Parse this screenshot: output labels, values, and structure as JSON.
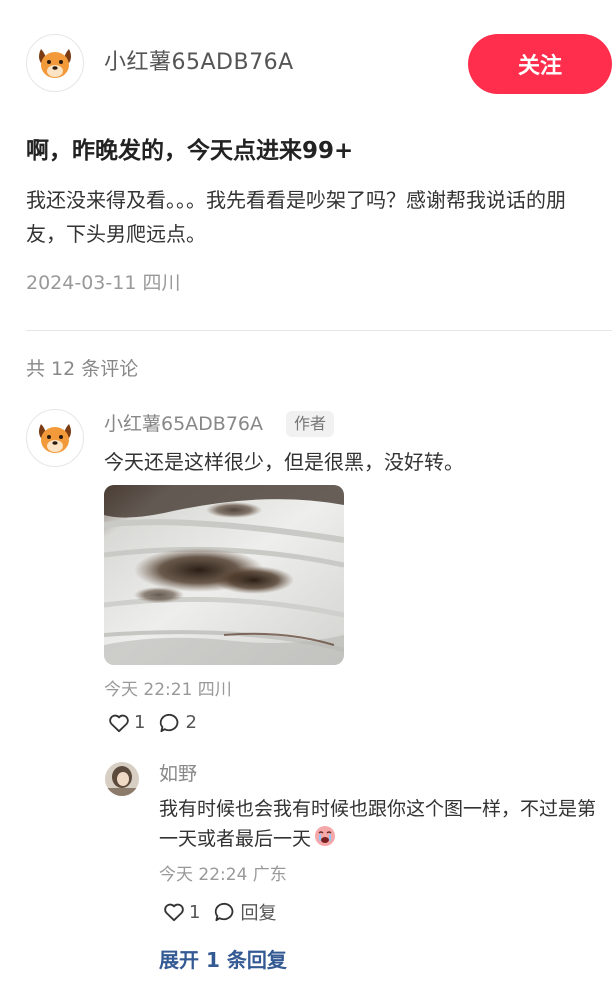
{
  "post": {
    "author": "小红薯65ADB76A",
    "follow_label": "关注",
    "title": "啊，昨晚发的，今天点进来99+",
    "body": "我还没来得及看。。。我先看看是吵架了吗？感谢帮我说话的朋友，下头男爬远点。",
    "meta": "2024-03-11 四川"
  },
  "comments_header": "共 12 条评论",
  "comment": {
    "author": "小红薯65ADB76A",
    "badge": "作者",
    "text": "今天还是这样很少，但是很黑，没好转。",
    "meta": "今天 22:21 四川",
    "likes": "1",
    "replies": "2",
    "avatar_icon": "dog-face-icon",
    "image_icon": "photo"
  },
  "reply": {
    "author": "如野",
    "text": "我有时候也会我有时候也跟你这个图一样，不过是第一天或者最后一天",
    "meta": "今天 22:24 广东",
    "likes": "1",
    "reply_label": "回复"
  },
  "expand_label": "展开 1 条回复",
  "colors": {
    "accent": "#ff2e4d",
    "link": "#345a94",
    "muted": "#999999"
  }
}
